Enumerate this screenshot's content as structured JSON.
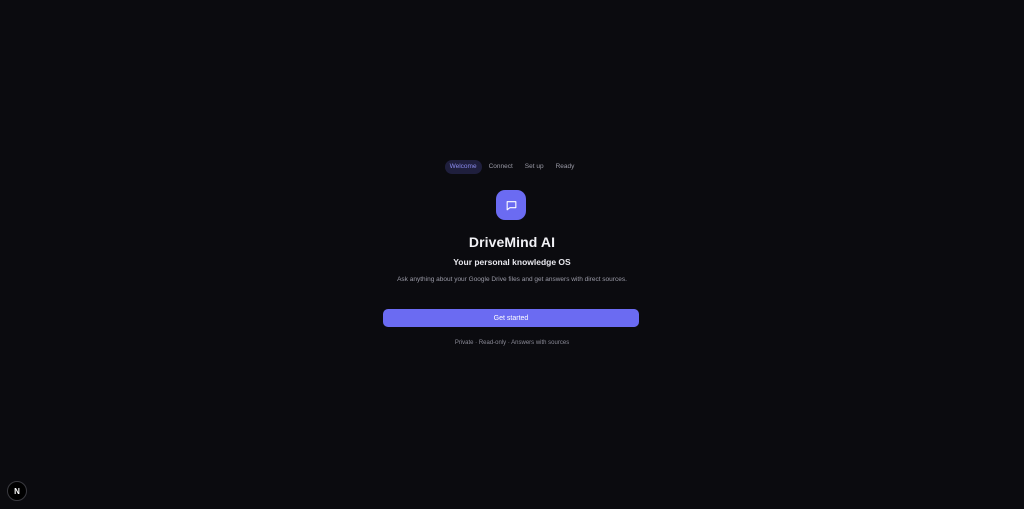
{
  "stepper": {
    "steps": [
      {
        "label": "Welcome",
        "active": true
      },
      {
        "label": "Connect",
        "active": false
      },
      {
        "label": "Set up",
        "active": false
      },
      {
        "label": "Ready",
        "active": false
      }
    ]
  },
  "hero": {
    "icon": "chat-bubble-icon",
    "title": "DriveMind AI",
    "subtitle": "Your personal knowledge OS",
    "description": "Ask anything about your Google Drive files and get answers with direct sources.",
    "cta_label": "Get started",
    "footnote": "Private · Read-only · Answers with sources"
  },
  "dev_badge": {
    "label": "N",
    "icon": "nextjs-icon"
  },
  "colors": {
    "background": "#0b0b0f",
    "accent": "#6b6bf2",
    "active_step_bg": "#1f1f3d",
    "active_step_text": "#8b8cf0"
  }
}
